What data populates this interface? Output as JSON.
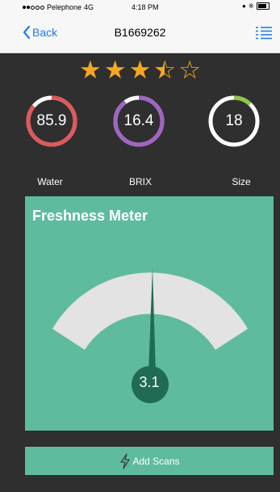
{
  "status_bar": {
    "carrier": "Pelephone",
    "network": "4G",
    "time": "4:18 PM"
  },
  "nav": {
    "back_label": "Back",
    "title": "B1669262",
    "right_icon": "list-icon"
  },
  "rating": {
    "value": 3.5,
    "max": 5
  },
  "stats": [
    {
      "value": "85.9",
      "label": "Water",
      "color": "#e0585b",
      "fraction": 0.86
    },
    {
      "value": "16.4",
      "label": "BRIX",
      "color": "#a064c4",
      "fraction": 0.9
    },
    {
      "value": "18",
      "label": "Size",
      "color": "#8ec54a",
      "fraction": 0.12
    }
  ],
  "freshness": {
    "title": "Freshness Meter",
    "value": "3.1",
    "needle_fraction": 0.49,
    "panel_color": "#5fbb9e",
    "needle_color": "#1f6b55"
  },
  "actions": {
    "add_scans_label": "Add Scans"
  },
  "colors": {
    "accent": "#1e7cf2",
    "star": "#f5a623",
    "background": "#2f2f2f"
  }
}
